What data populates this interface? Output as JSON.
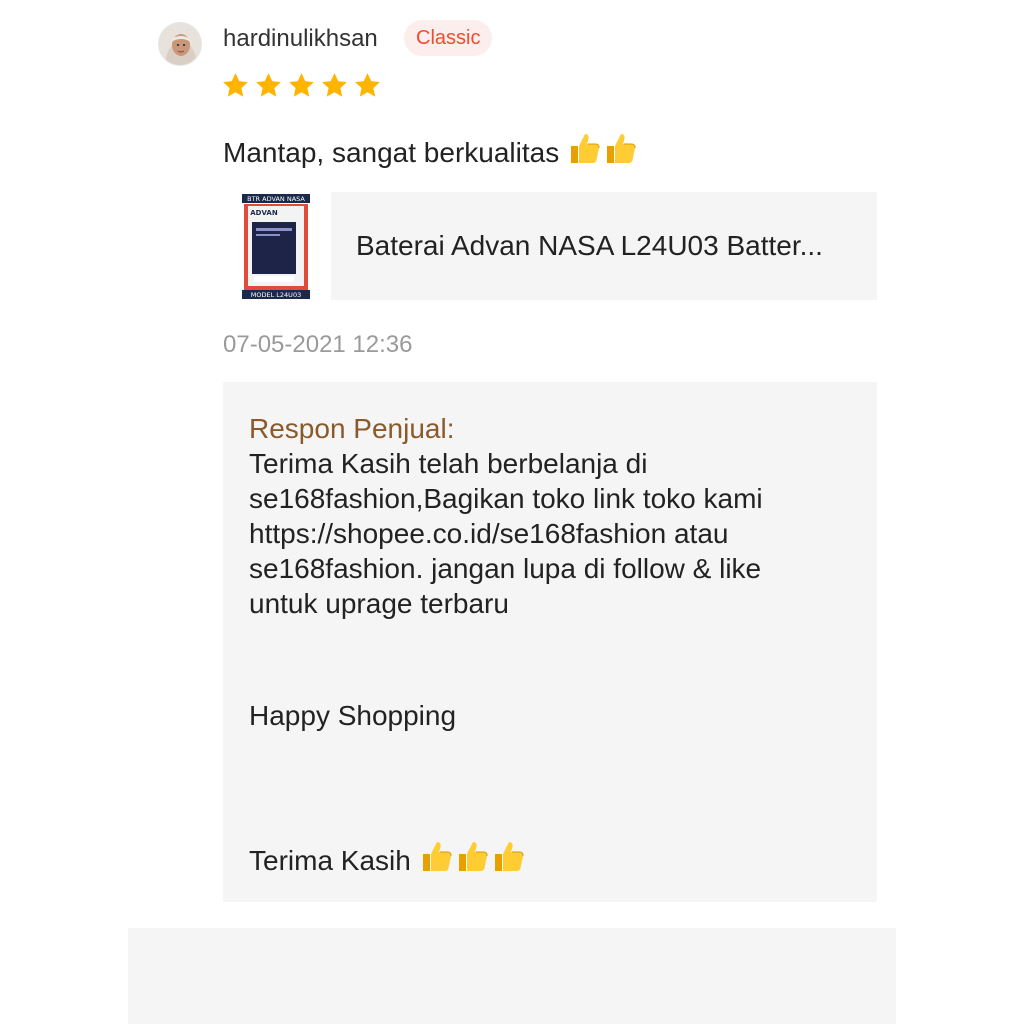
{
  "review": {
    "username": "hardinulikhsan",
    "badge": "Classic",
    "rating": 5,
    "star_color": "#ffb400",
    "text": "Mantap, sangat berkualitas",
    "text_emoji": "thumbs-up-icon x2",
    "timestamp": "07-05-2021 12:36"
  },
  "product": {
    "thumb_caption_top": "BTR ADVAN NASA",
    "thumb_brand": "ADVAN",
    "thumb_caption_bottom": "MODEL L24U03",
    "name": "Baterai Advan NASA L24U03 Batter..."
  },
  "seller_response": {
    "title": "Respon Penjual:",
    "lines": [
      "Terima Kasih telah berbelanja di",
      "se168fashion,Bagikan toko link toko kami",
      "https://shopee.co.id/se168fashion atau",
      "se168fashion. jangan lupa di follow & like",
      "untuk uprage terbaru"
    ],
    "happy": "Happy Shopping",
    "thanks": "Terima Kasih",
    "thanks_emoji": "thumbs-up-icon x3"
  },
  "colors": {
    "accent": "#ee4d2d",
    "response_title": "#8a5a2b",
    "panel_bg": "#f5f5f5"
  }
}
